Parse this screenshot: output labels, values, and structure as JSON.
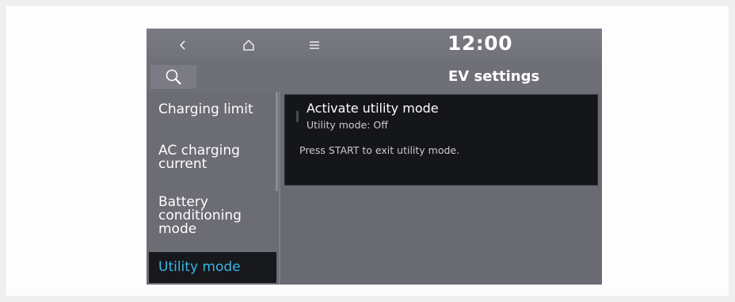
{
  "status_bar": {
    "clock": "12:00",
    "back_icon": "back-icon",
    "home_icon": "home-icon",
    "menu_icon": "menu-icon"
  },
  "header": {
    "title": "EV settings",
    "search_icon": "search-icon"
  },
  "sidebar": {
    "items": [
      {
        "label_lines": [
          "Charging limit"
        ],
        "selected": false
      },
      {
        "label_lines": [
          "AC charging",
          "current"
        ],
        "selected": false
      },
      {
        "label_lines": [
          "Battery",
          "conditioning",
          "mode"
        ],
        "selected": false
      },
      {
        "label_lines": [
          "Utility mode"
        ],
        "selected": true
      }
    ]
  },
  "content": {
    "option_title": "Activate utility mode",
    "option_status": "Utility mode: Off",
    "description": "Press START to exit utility mode."
  },
  "colors": {
    "accent": "#38b6e6",
    "screen_bg": "#6a6b72",
    "card_bg": "#15161a"
  }
}
